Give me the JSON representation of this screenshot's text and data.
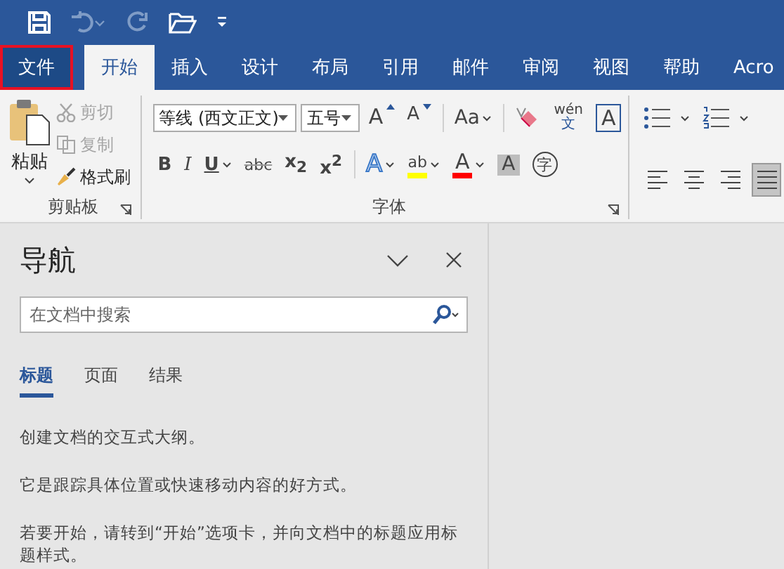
{
  "quick_access": [
    {
      "kind": "save",
      "disabled": false
    },
    {
      "kind": "undo",
      "disabled": true
    },
    {
      "kind": "redo",
      "disabled": true
    },
    {
      "kind": "open",
      "disabled": false
    },
    {
      "kind": "customize",
      "disabled": false
    }
  ],
  "tabs": [
    {
      "kind": "file",
      "label": "文件",
      "selected": false,
      "outlined": true
    },
    {
      "kind": "tab",
      "label": "开始",
      "selected": true,
      "outlined": false
    },
    {
      "kind": "tab",
      "label": "插入",
      "selected": false,
      "outlined": false
    },
    {
      "kind": "tab",
      "label": "设计",
      "selected": false,
      "outlined": false
    },
    {
      "kind": "tab",
      "label": "布局",
      "selected": false,
      "outlined": false
    },
    {
      "kind": "tab",
      "label": "引用",
      "selected": false,
      "outlined": false
    },
    {
      "kind": "tab",
      "label": "邮件",
      "selected": false,
      "outlined": false
    },
    {
      "kind": "tab",
      "label": "审阅",
      "selected": false,
      "outlined": false
    },
    {
      "kind": "tab",
      "label": "视图",
      "selected": false,
      "outlined": false
    },
    {
      "kind": "tab",
      "label": "帮助",
      "selected": false,
      "outlined": false
    },
    {
      "kind": "tab",
      "label": "Acro",
      "selected": false,
      "outlined": false
    }
  ],
  "clipboard": {
    "paste": "粘贴",
    "cut": {
      "label": "剪切",
      "disabled": true
    },
    "copy": {
      "label": "复制",
      "disabled": true
    },
    "format_painter": "格式刷",
    "group_label": "剪贴板"
  },
  "font": {
    "name": "等线 (西文正文)",
    "size": "五号",
    "group_label": "字体",
    "row1": [
      {
        "kind": "grow",
        "label": "A",
        "dropdown": false
      },
      {
        "kind": "shrink",
        "label": "A",
        "dropdown": false
      },
      {
        "kind": "case",
        "label": "Aa",
        "dropdown": true
      },
      {
        "kind": "clear",
        "dropdown": false
      },
      {
        "kind": "phonetic",
        "label": "wén",
        "sub": "文",
        "dropdown": false
      },
      {
        "kind": "border",
        "label": "A",
        "dropdown": false
      }
    ],
    "row2": [
      {
        "kind": "bold",
        "label": "B",
        "dropdown": false
      },
      {
        "kind": "italic",
        "label": "I",
        "dropdown": false
      },
      {
        "kind": "underline",
        "label": "U",
        "dropdown": true
      },
      {
        "kind": "strike",
        "label": "abc",
        "dropdown": false
      },
      {
        "kind": "subscript",
        "label": "x$_{2}$",
        "dropdown": false
      },
      {
        "kind": "superscript",
        "label": "x$^{2}$",
        "dropdown": false
      },
      {
        "kind": "effect",
        "label": "A",
        "dropdown": true
      },
      {
        "kind": "highlight",
        "label": "ab",
        "dropdown": true,
        "color": "#ffff00"
      },
      {
        "kind": "color",
        "label": "A",
        "dropdown": true,
        "color": "#ff0000"
      },
      {
        "kind": "shading",
        "label": "A",
        "dropdown": false
      },
      {
        "kind": "enclose",
        "label": "字",
        "dropdown": false
      }
    ]
  },
  "paragraph": {
    "row1": [
      {
        "kind": "bullets"
      },
      {
        "kind": "numbering"
      }
    ],
    "row2": [
      {
        "kind": "align-left",
        "selected": false
      },
      {
        "kind": "center",
        "selected": false
      },
      {
        "kind": "align-right",
        "selected": false
      },
      {
        "kind": "justify",
        "selected": true
      }
    ]
  },
  "navigation": {
    "title": "导航",
    "search": {
      "placeholder": "在文档中搜索"
    },
    "tabs": [
      {
        "label": "标题",
        "selected": true
      },
      {
        "label": "页面",
        "selected": false
      },
      {
        "label": "结果",
        "selected": false
      }
    ],
    "messages": [
      "创建文档的交互式大纲。",
      "它是跟踪具体位置或快速移动内容的好方式。",
      "若要开始，请转到“开始”选项卡，并向文档中的标题应用标题样式。"
    ]
  }
}
